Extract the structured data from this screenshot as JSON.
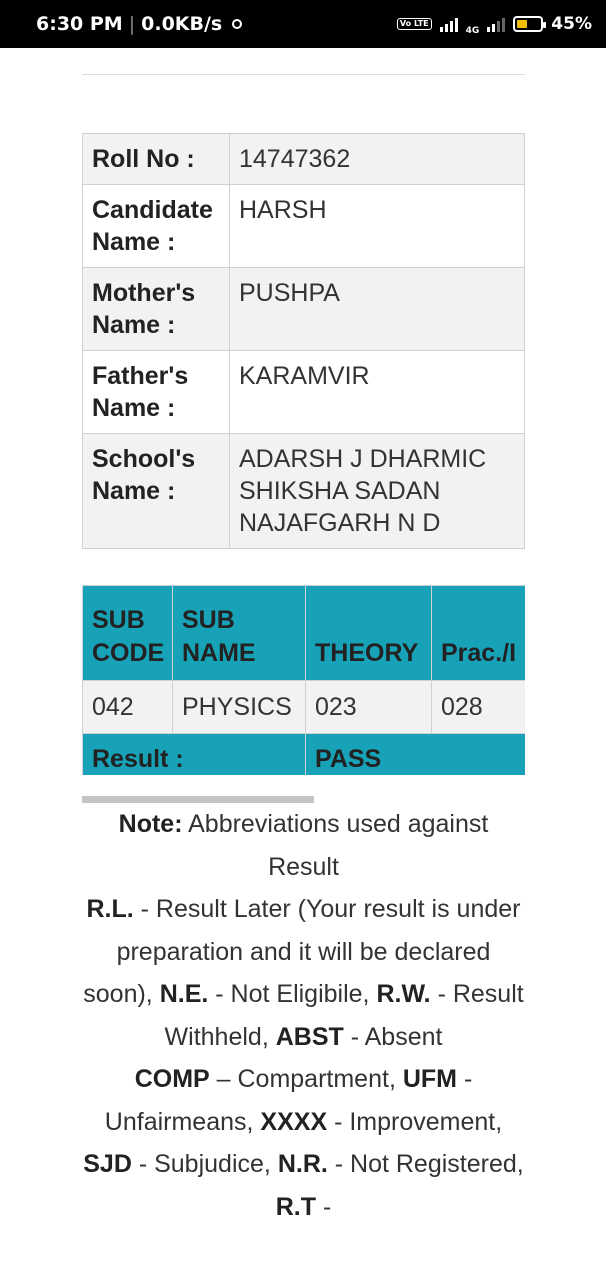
{
  "status": {
    "time": "6:30 PM",
    "speed": "0.0KB/s",
    "volte": "Vo LTE",
    "network": "4G",
    "battery": "45%",
    "battery_level": 0.45
  },
  "info": [
    {
      "label": "Roll No :",
      "value": "14747362"
    },
    {
      "label": "Candidate Name :",
      "value": "HARSH"
    },
    {
      "label": "Mother's Name :",
      "value": "PUSHPA"
    },
    {
      "label": "Father's Name :",
      "value": "KARAMVIR"
    },
    {
      "label": "School's Name :",
      "value": "ADARSH J DHARMIC SHIKSHA SADAN NAJAFGARH N D"
    }
  ],
  "marks": {
    "headers": [
      "SUB CODE",
      "SUB NAME",
      "THEORY",
      "Prac./I"
    ],
    "rows": [
      [
        "042",
        "PHYSICS",
        "023",
        "028"
      ]
    ],
    "result_label": "Result :",
    "result_value": "PASS"
  },
  "note": {
    "title": "Note:",
    "intro": "Abbreviations used against Result",
    "items": [
      {
        "abbr": "R.L.",
        "desc": " - Result Later (Your result is under preparation and it will be declared soon), "
      },
      {
        "abbr": "N.E.",
        "desc": " - Not Eligibile, "
      },
      {
        "abbr": "R.W.",
        "desc": " - Result Withheld, "
      },
      {
        "abbr": "ABST",
        "desc": " - Absent"
      },
      {
        "abbr": "COMP",
        "desc": " – Compartment, "
      },
      {
        "abbr": "UFM",
        "desc": " - Unfairmeans, "
      },
      {
        "abbr": "XXXX",
        "desc": " - Improvement, "
      },
      {
        "abbr": "SJD",
        "desc": " - Subjudice, "
      },
      {
        "abbr": "N.R.",
        "desc": " - Not Registered, "
      },
      {
        "abbr": "R.T",
        "desc": " - "
      }
    ]
  },
  "colors": {
    "header_accent": "#17a2b8",
    "row_shade": "#f2f2f2"
  }
}
